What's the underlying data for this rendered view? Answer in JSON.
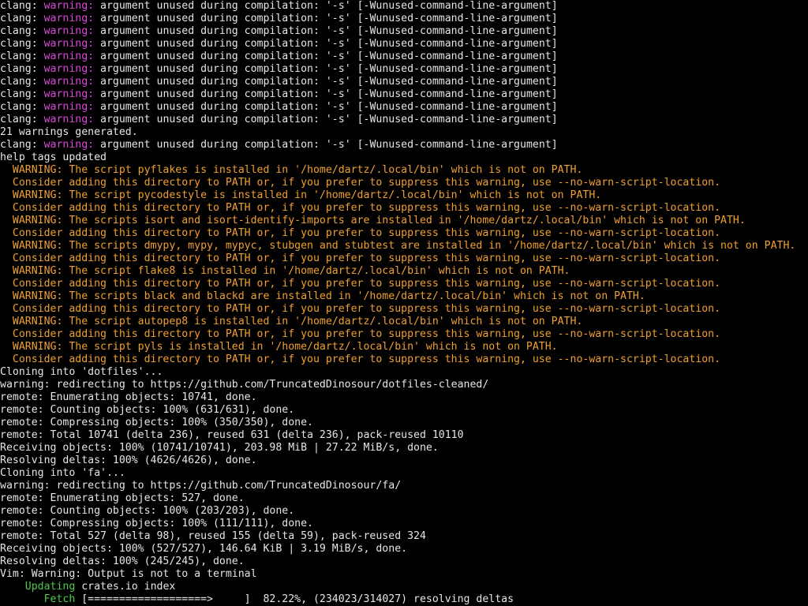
{
  "colors": {
    "background": "#000000",
    "text": "#e6e6e6",
    "warning_tag": "#d84ad8",
    "pip_warning": "#f0a030",
    "cargo_status": "#4ec94e"
  },
  "clang": {
    "prefix": "clang: ",
    "tag": "warning:",
    "message": " argument unused during compilation: '-s' [-Wunused-command-line-argument]",
    "summary": "21 warnings generated."
  },
  "help_tags": "help tags updated",
  "pip_warnings": [
    "  WARNING: The script pyflakes is installed in '/home/dartz/.local/bin' which is not on PATH.",
    "  Consider adding this directory to PATH or, if you prefer to suppress this warning, use --no-warn-script-location.",
    "  WARNING: The script pycodestyle is installed in '/home/dartz/.local/bin' which is not on PATH.",
    "  Consider adding this directory to PATH or, if you prefer to suppress this warning, use --no-warn-script-location.",
    "  WARNING: The scripts isort and isort-identify-imports are installed in '/home/dartz/.local/bin' which is not on PATH.",
    "  Consider adding this directory to PATH or, if you prefer to suppress this warning, use --no-warn-script-location.",
    "  WARNING: The scripts dmypy, mypy, mypyc, stubgen and stubtest are installed in '/home/dartz/.local/bin' which is not on PATH.",
    "  Consider adding this directory to PATH or, if you prefer to suppress this warning, use --no-warn-script-location.",
    "  WARNING: The script flake8 is installed in '/home/dartz/.local/bin' which is not on PATH.",
    "  Consider adding this directory to PATH or, if you prefer to suppress this warning, use --no-warn-script-location.",
    "  WARNING: The scripts black and blackd are installed in '/home/dartz/.local/bin' which is not on PATH.",
    "  Consider adding this directory to PATH or, if you prefer to suppress this warning, use --no-warn-script-location.",
    "  WARNING: The script autopep8 is installed in '/home/dartz/.local/bin' which is not on PATH.",
    "  Consider adding this directory to PATH or, if you prefer to suppress this warning, use --no-warn-script-location.",
    "  WARNING: The script pyls is installed in '/home/dartz/.local/bin' which is not on PATH.",
    "  Consider adding this directory to PATH or, if you prefer to suppress this warning, use --no-warn-script-location."
  ],
  "git_dotfiles": [
    "Cloning into 'dotfiles'...",
    "warning: redirecting to https://github.com/TruncatedDinosour/dotfiles-cleaned/",
    "remote: Enumerating objects: 10741, done.",
    "remote: Counting objects: 100% (631/631), done.",
    "remote: Compressing objects: 100% (350/350), done.",
    "remote: Total 10741 (delta 236), reused 631 (delta 236), pack-reused 10110",
    "Receiving objects: 100% (10741/10741), 203.98 MiB | 27.22 MiB/s, done.",
    "Resolving deltas: 100% (4626/4626), done."
  ],
  "git_fa": [
    "Cloning into 'fa'...",
    "warning: redirecting to https://github.com/TruncatedDinosour/fa/",
    "remote: Enumerating objects: 527, done.",
    "remote: Counting objects: 100% (203/203), done.",
    "remote: Compressing objects: 100% (111/111), done.",
    "remote: Total 527 (delta 98), reused 155 (delta 59), pack-reused 324",
    "Receiving objects: 100% (527/527), 146.64 KiB | 3.19 MiB/s, done.",
    "Resolving deltas: 100% (245/245), done."
  ],
  "vim_warning": "Vim: Warning: Output is not to a terminal",
  "cargo": {
    "updating_indent": "    ",
    "updating_label": "Updating",
    "updating_text": " crates.io index",
    "fetch_indent": "       ",
    "fetch_label": "Fetch",
    "fetch_bar": " [===================>     ]  82.22%, (234023/314027) resolving deltas"
  }
}
